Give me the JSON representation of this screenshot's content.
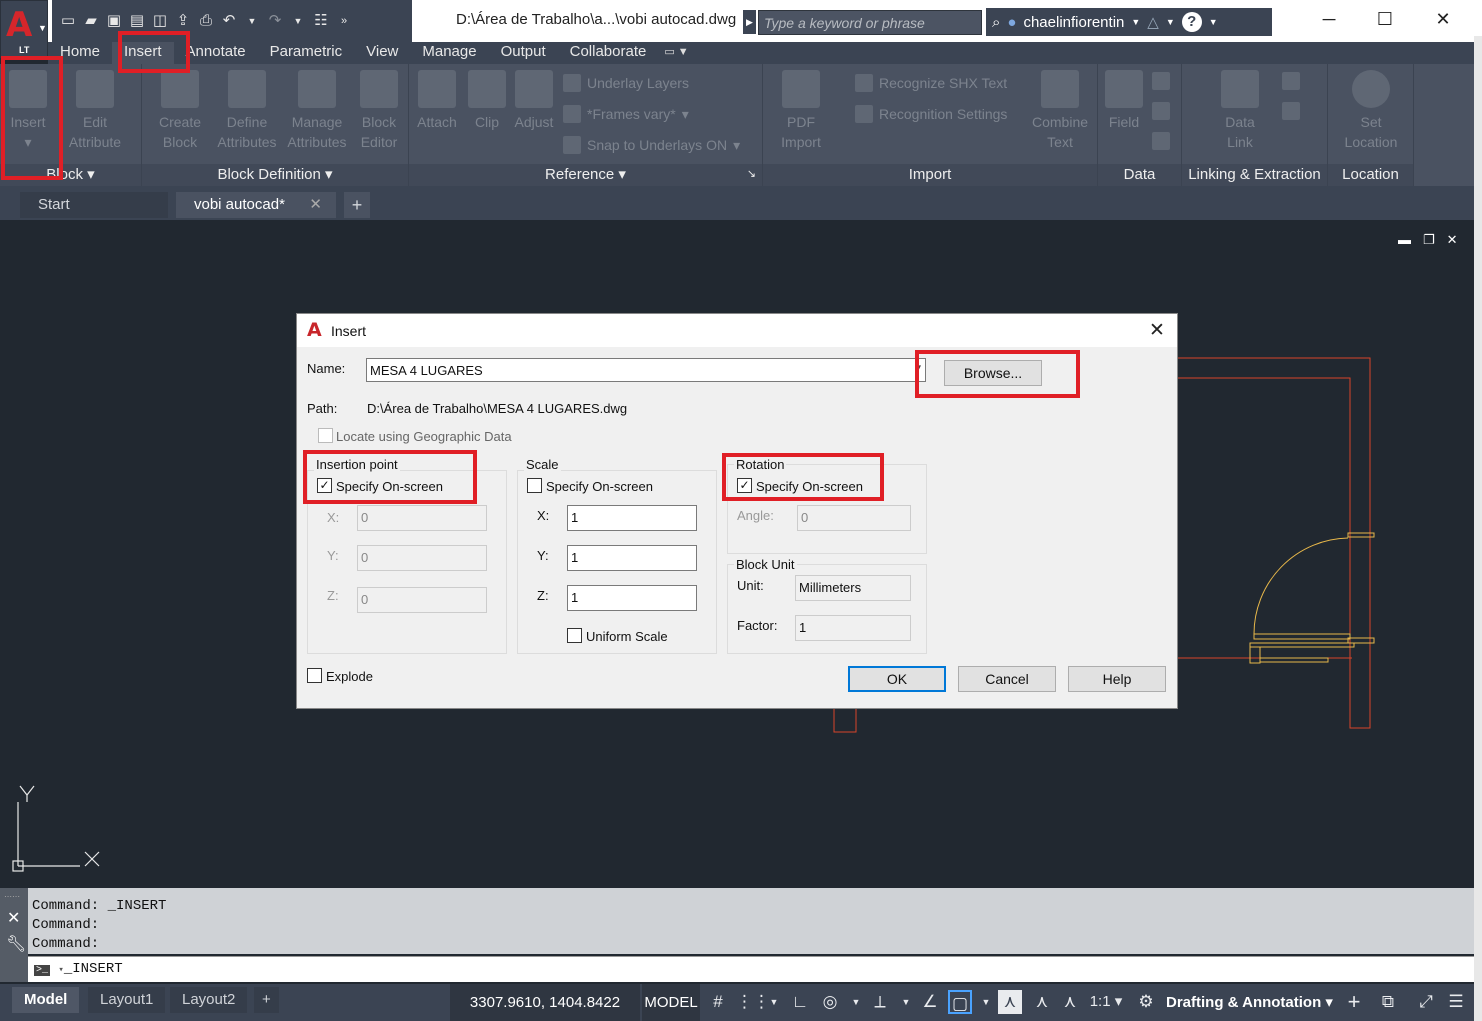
{
  "titlebar": {
    "app_badge": "LT",
    "doc_title": "D:\\Área de Trabalho\\a...\\vobi autocad.dwg",
    "search_placeholder": "Type a keyword or phrase",
    "username": "chaelinfiorentin"
  },
  "ribbon_tabs": [
    "Home",
    "Insert",
    "Annotate",
    "Parametric",
    "View",
    "Manage",
    "Output",
    "Collaborate"
  ],
  "active_tab": "Insert",
  "ribbon": {
    "block": {
      "title": "Block",
      "insert": "Insert",
      "edit_attribute": "Edit\nAttribute"
    },
    "block_definition": {
      "title": "Block Definition",
      "create_block": "Create\nBlock",
      "define_attributes": "Define\nAttributes",
      "manage_attributes": "Manage\nAttributes",
      "block_editor": "Block\nEditor"
    },
    "reference": {
      "title": "Reference",
      "attach": "Attach",
      "clip": "Clip",
      "adjust": "Adjust",
      "underlay_layers": "Underlay Layers",
      "frames_vary": "*Frames vary*",
      "snap_underlays": "Snap to Underlays ON"
    },
    "import": {
      "title": "Import",
      "pdf_import": "PDF\nImport",
      "recognize_shx": "Recognize SHX Text",
      "recognition_settings": "Recognition Settings",
      "combine_text": "Combine\nText"
    },
    "data": {
      "title": "Data",
      "field": "Field"
    },
    "linking": {
      "title": "Linking & Extraction",
      "data_link": "Data\nLink"
    },
    "location": {
      "title": "Location",
      "set_location": "Set\nLocation"
    }
  },
  "doc_tabs": {
    "start": "Start",
    "file": "vobi autocad*"
  },
  "dialog": {
    "title": "Insert",
    "name_label": "Name:",
    "name_value": "MESA 4 LUGARES",
    "browse": "Browse...",
    "path_label": "Path:",
    "path_value": "D:\\Área de Trabalho\\MESA 4 LUGARES.dwg",
    "geo_label": "Locate using Geographic Data",
    "insertion": {
      "title": "Insertion point",
      "specify": "Specify On-screen",
      "x_label": "X:",
      "y_label": "Y:",
      "z_label": "Z:",
      "x": "0",
      "y": "0",
      "z": "0"
    },
    "scale": {
      "title": "Scale",
      "specify": "Specify On-screen",
      "x_label": "X:",
      "y_label": "Y:",
      "z_label": "Z:",
      "x": "1",
      "y": "1",
      "z": "1",
      "uniform": "Uniform Scale"
    },
    "rotation": {
      "title": "Rotation",
      "specify": "Specify On-screen",
      "angle_label": "Angle:",
      "angle": "0"
    },
    "block_unit": {
      "title": "Block Unit",
      "unit_label": "Unit:",
      "unit": "Millimeters",
      "factor_label": "Factor:",
      "factor": "1"
    },
    "explode": "Explode",
    "ok": "OK",
    "cancel": "Cancel",
    "help": "Help"
  },
  "command": {
    "history": [
      "Command:  _INSERT",
      "Command:",
      "Command:"
    ],
    "input": "_INSERT"
  },
  "status": {
    "layouts": [
      "Model",
      "Layout1",
      "Layout2"
    ],
    "coords": "3307.9610, 1404.8422",
    "mode": "MODEL",
    "scale": "1:1",
    "workspace": "Drafting & Annotation"
  },
  "colors": {
    "highlight": "#e01f26",
    "drawing_line": "#e8b84a",
    "drawing_wall": "#d6442a"
  }
}
